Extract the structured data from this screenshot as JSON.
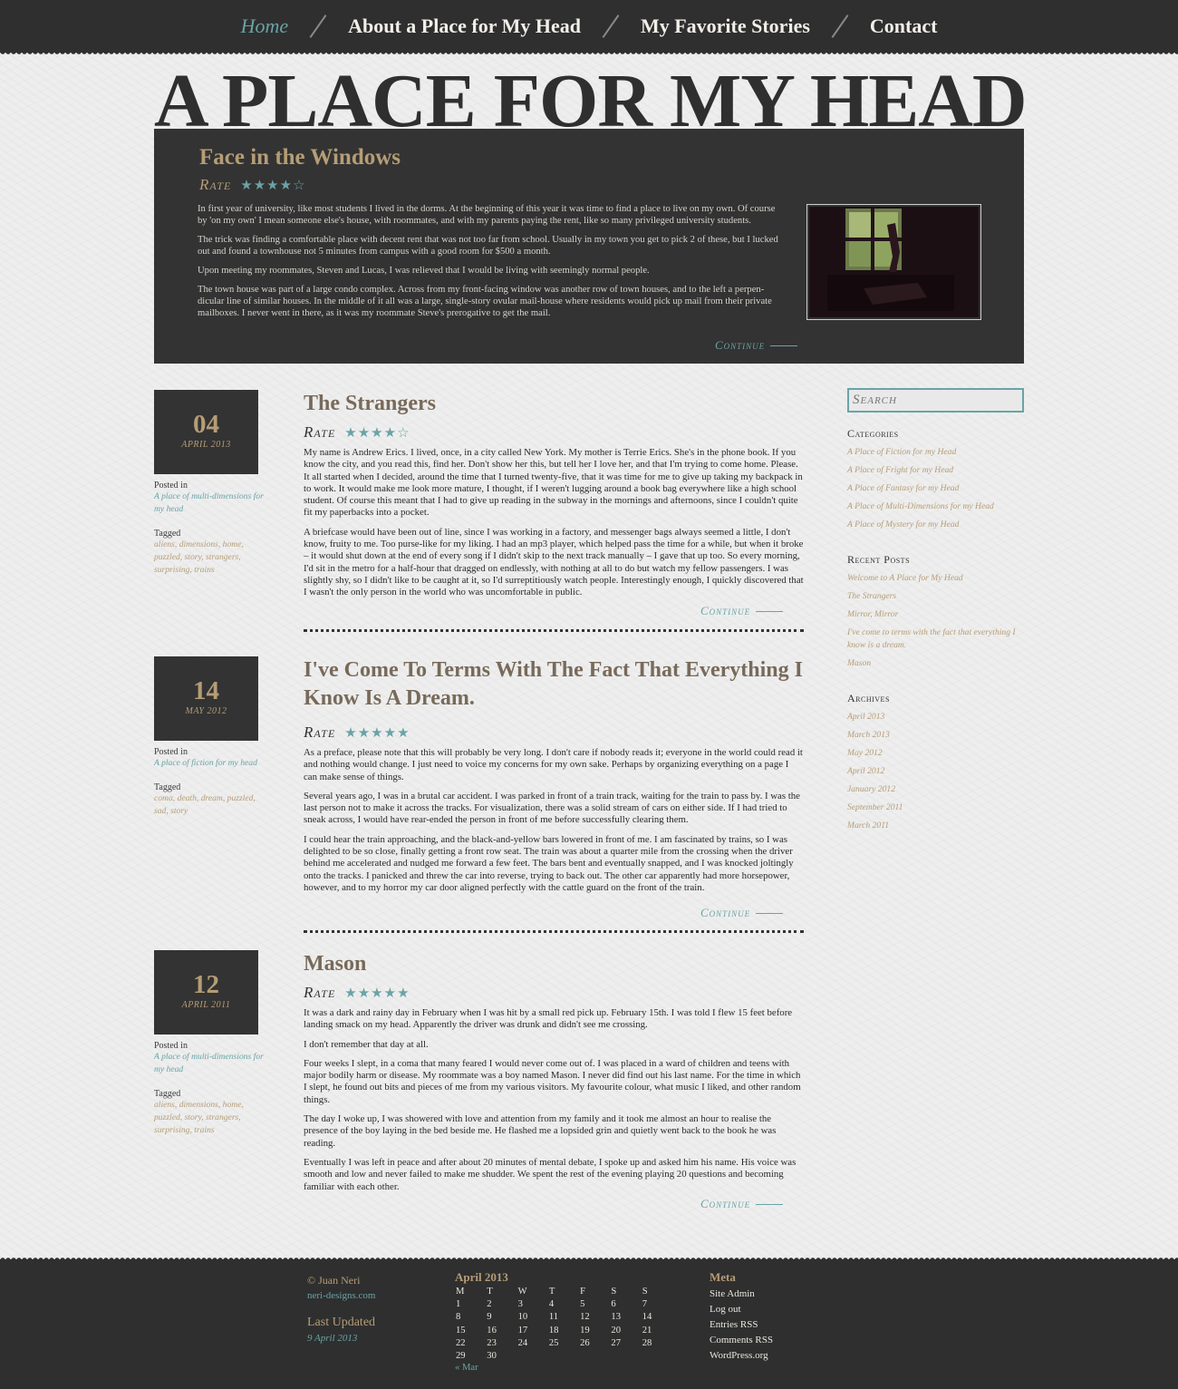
{
  "nav": {
    "items": [
      "Home",
      "About a Place for My Head",
      "My Favorite Stories",
      "Contact"
    ]
  },
  "site_title": "A PLACE FOR MY HEAD",
  "rate_label": "Rate",
  "continue_label": "Continue",
  "featured": {
    "title": "Face in the Windows",
    "stars": "★★★★☆",
    "rating": 4,
    "paragraphs": [
      "In first year of university, like most students I lived in the dorms. At the beginning of this year it was time to find a place to live on my own. Of course by 'on my own' I mean someone else's house, with roommates, and with my parents paying the rent, like so many privileged university students.",
      "The trick was finding a comfortable place with decent rent that was not too far from school. Usually in my town you get to pick 2 of these, but I lucked out and found a townhouse not 5 minutes from campus with a good room for $500 a month.",
      "Upon meeting my roommates, Steven and Lucas, I was relieved that I would be living with seemingly normal people.",
      "The town house was part of a large condo complex. Across from my front-facing window was another row of town houses, and to the left a perpen-dicular line of similar houses. In the middle of it all was a large, single-story ovular mail-house where residents would pick up mail from their private mailboxes. I never went in there, as it was my roommate Steve's prerogative to get the mail."
    ]
  },
  "posts": [
    {
      "day": "04",
      "month": "APRIL 2013",
      "posted_in_label": "Posted in",
      "category": "A place of multi-dimensions for my head",
      "tagged_label": "Tagged",
      "tags": "aliens, dimensions, home, puzzled, story, strangers, surprising, trains",
      "title": "The Strangers",
      "stars": "★★★★☆",
      "rating": 4,
      "paragraphs": [
        "My name is Andrew Erics. I lived, once, in a city called New York. My mother is Terrie Erics. She's in the phone book. If you know the city, and you read this, find her. Don't show her this, but tell her I love her, and that I'm trying to come home. Please. It all started when I decided, around the time that I turned twenty-five, that it was time for me to give up taking my backpack in to work. It would make me look more mature, I thought, if I weren't lugging around a book bag everywhere like a high school student. Of course this meant that I had to give up reading in the subway in the mornings and afternoons, since I couldn't quite fit my paperbacks into a pocket.",
        "A briefcase would have been out of line, since I was working in a factory, and messenger bags always seemed a little, I don't know, fruity to me. Too purse-like for my liking. I had an mp3 player, which helped pass the time for a while, but when it broke – it would shut down at the end of every song if I didn't skip to the next track manually – I gave that up too. So every morning, I'd sit in the metro for a half-hour that dragged on endlessly, with nothing at all to do but watch my fellow passengers. I was slightly shy, so I didn't like to be caught at it, so I'd surreptitiously watch people. Interestingly enough, I quickly discovered that I wasn't the only person in the world who was uncomfortable in public."
      ]
    },
    {
      "day": "14",
      "month": "MAY 2012",
      "posted_in_label": "Posted in",
      "category": "A place of fiction for my head",
      "tagged_label": "Tagged",
      "tags": "coma, death, dream, puzzled, sad, story",
      "title": "I've Come To Terms With The Fact That Everything I Know Is A Dream.",
      "stars": "★★★★★",
      "rating": 5,
      "paragraphs": [
        "As a preface, please note that this will probably be very long. I don't care if nobody reads it; everyone in the world could read it and nothing would change. I just need to voice my concerns for my own sake. Perhaps by organizing everything on a page I can make sense of things.",
        "Several years ago, I was in a brutal car accident. I was parked in front of a train track, waiting for the train to pass by. I was the last person not to make it across the tracks. For visualization, there was a solid stream of cars on either side. If I had tried to sneak across, I would have rear-ended the person in front of me before successfully clearing them.",
        "I could hear the train approaching, and the black-and-yellow bars lowered in front of me. I am fascinated by trains, so I was delighted to be so close, finally getting a front row seat. The train was about a quarter mile from the crossing when the driver behind me accelerated and nudged me forward a few feet. The bars bent and eventually snapped, and I was knocked joltingly onto the tracks. I panicked and threw the car into reverse, trying to back out. The other car apparently had more horsepower, however, and to my horror my car door aligned perfectly with the cattle guard on the front of the train."
      ]
    },
    {
      "day": "12",
      "month": "APRIL 2011",
      "posted_in_label": "Posted in",
      "category": "A place of multi-dimensions for my head",
      "tagged_label": "Tagged",
      "tags": "aliens, dimensions, home, puzzled, story, strangers, surprising, trains",
      "title": "Mason",
      "stars": "★★★★★",
      "rating": 5,
      "paragraphs": [
        "It was a dark and rainy day in February when I was hit by a small red pick up. February 15th. I was told I flew 15 feet before landing smack on my head. Apparently the driver was drunk and didn't see me crossing.",
        "I don't remember that day at all.",
        "Four weeks I slept, in a coma that many feared I would never come out of. I was placed in a ward of children and teens with major bodily harm or disease. My roommate was a boy named Mason. I never did find out his last name. For the time in which I slept, he found out bits and pieces of me from my various visitors. My favourite colour, what music I liked, and other random things.",
        "The day I woke up, I was showered with love and attention from my family and it took me almost an hour to realise the presence of the boy laying in the bed beside me. He flashed me a lopsided grin and quietly went back to the book he was reading.",
        "Eventually I was left in peace and after about 20 minutes of mental debate, I spoke up and asked him his name. His voice was smooth and low and never failed to make me shudder. We spent the rest of the evening playing 20 questions and becoming familiar with each other."
      ]
    }
  ],
  "sidebar": {
    "search_placeholder": "Search",
    "categories_heading": "Categories",
    "categories": [
      "A Place of Fiction for my Head",
      "A Place of Fright for my Head",
      "A Place of Fantasy for my Head",
      "A Place of Multi-Dimensions for my Head",
      "A Place of Mystery for my Head"
    ],
    "recent_heading": "Recent Posts",
    "recent": [
      "Welcome to A Place for My Head",
      "The Strangers",
      "Mirror, Mirror",
      "I've come to terms with the fact that everything I know is a dream.",
      "Mason"
    ],
    "archives_heading": "Archives",
    "archives": [
      "April 2013",
      "March 2013",
      "May 2012",
      "April 2012",
      "January 2012",
      "September 2011",
      "March 2011"
    ]
  },
  "footer": {
    "copyright": "© Juan Neri",
    "site": "neri-designs.com",
    "last_updated_label": "Last Updated",
    "last_updated_date": "9 April 2013",
    "calendar": {
      "caption": "April 2013",
      "headers": [
        "M",
        "T",
        "W",
        "T",
        "F",
        "S",
        "S"
      ],
      "rows": [
        [
          "1",
          "2",
          "3",
          "4",
          "5",
          "6",
          "7"
        ],
        [
          "8",
          "9",
          "10",
          "11",
          "12",
          "13",
          "14"
        ],
        [
          "15",
          "16",
          "17",
          "18",
          "19",
          "20",
          "21"
        ],
        [
          "22",
          "23",
          "24",
          "25",
          "26",
          "27",
          "28"
        ],
        [
          "29",
          "30",
          "",
          "",
          "",
          "",
          ""
        ]
      ],
      "prev": "« Mar"
    },
    "meta_heading": "Meta",
    "meta_links": [
      "Site Admin",
      "Log out",
      "Entries RSS",
      "Comments RSS",
      "WordPress.org"
    ]
  },
  "colors": {
    "dark": "#2f2f2f",
    "accent_teal": "#6aa3a6",
    "accent_tan": "#b59d76",
    "page_bg": "#eeeeee"
  }
}
